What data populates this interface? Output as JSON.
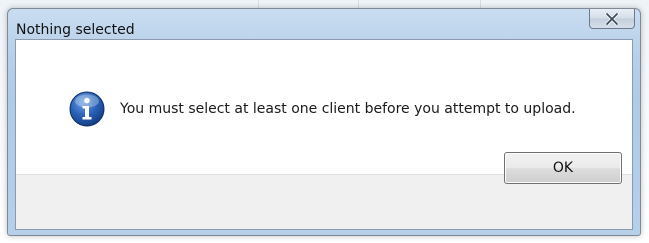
{
  "dialog": {
    "title": "Nothing selected",
    "close_icon": "close-icon",
    "message_icon": "information-icon",
    "message": "You must select at least one client before you attempt to upload.",
    "ok_label": "OK"
  },
  "colors": {
    "title_bar": "#b9d1ea",
    "info_icon": "#2a63b8",
    "button_area": "#f0f0f0",
    "close_glyph": "#3d4a5c"
  }
}
